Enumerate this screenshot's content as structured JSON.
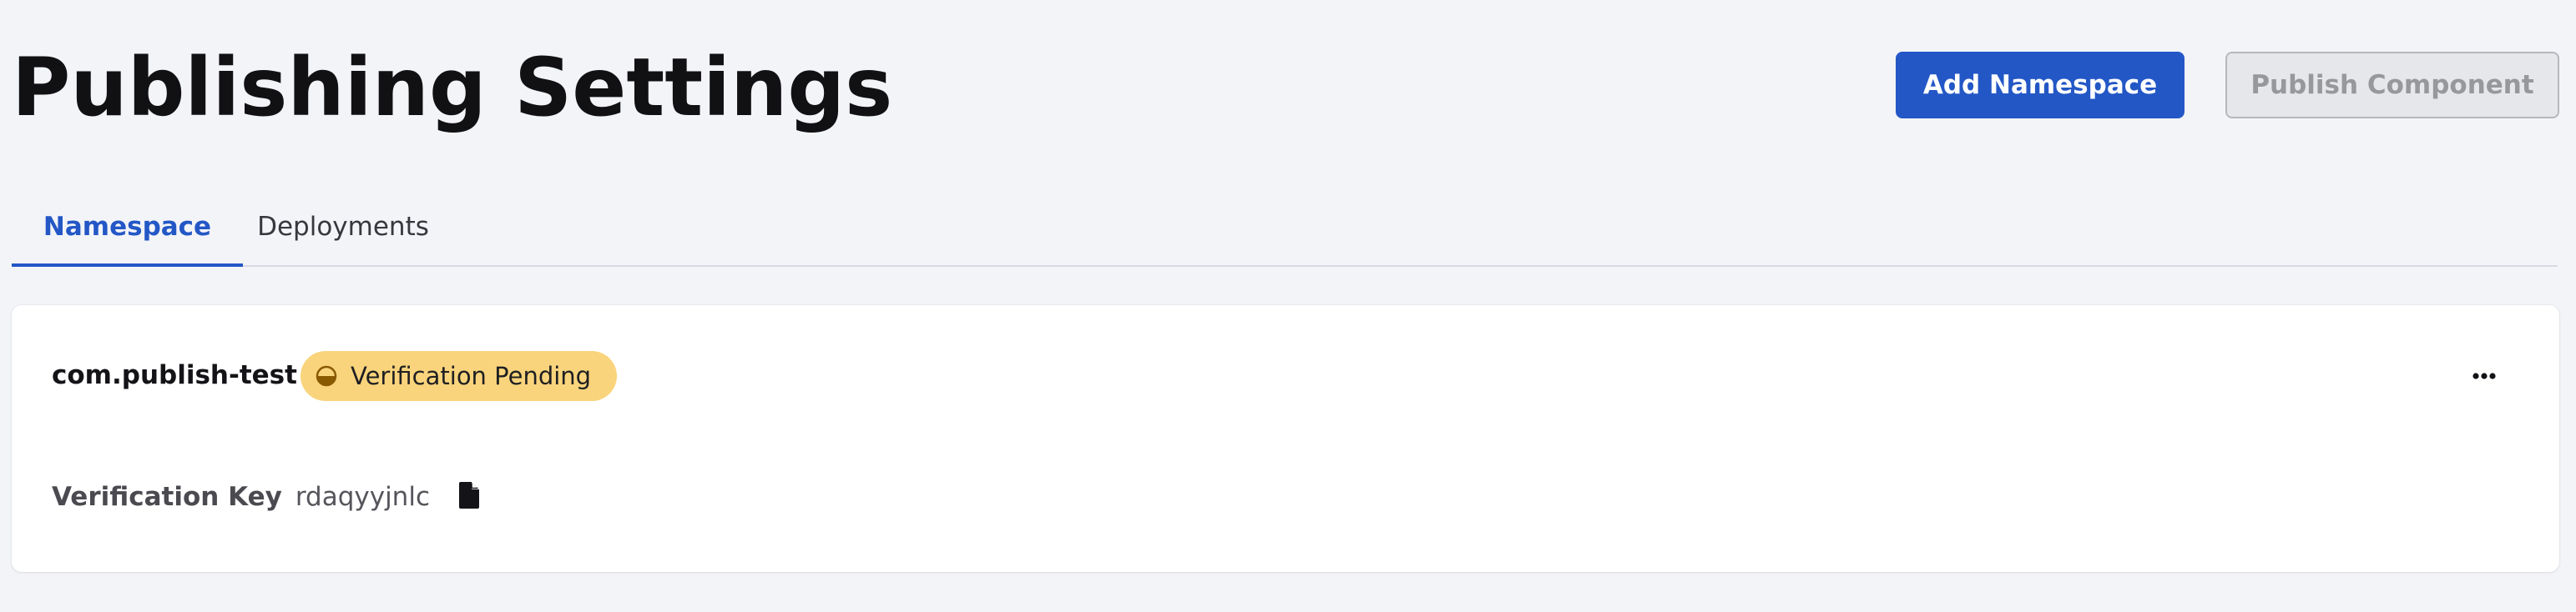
{
  "header": {
    "title": "Publishing Settings",
    "add_namespace_label": "Add Namespace",
    "publish_component_label": "Publish Component"
  },
  "tabs": [
    {
      "label": "Namespace",
      "active": true
    },
    {
      "label": "Deployments",
      "active": false
    }
  ],
  "namespace_card": {
    "name": "com.publish-test",
    "status": {
      "label": "Verification Pending",
      "icon": "half-circle-pending-icon",
      "color": "#f9d47c"
    },
    "more_icon": "ellipsis-icon",
    "verification_key_label": "Verification Key",
    "verification_key_value": "rdaqyyjnlc",
    "copy_icon": "document-copy-icon"
  },
  "colors": {
    "accent": "#2357c6",
    "background": "#f3f4f8",
    "card": "#ffffff",
    "badge": "#f9d47c",
    "disabled_button": "#e6e7ea"
  }
}
